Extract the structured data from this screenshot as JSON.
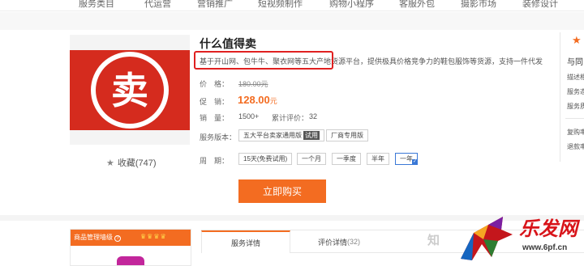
{
  "topnav": {
    "items": [
      "服务类目",
      "代运营",
      "营销推广",
      "短视频制作",
      "购物小程序",
      "客服外包",
      "摄影市场",
      "装修设计"
    ]
  },
  "product": {
    "thumbnail_glyph": "卖",
    "favorites_label": "收藏(747)",
    "title": "什么值得卖",
    "description": "基于开山网、包牛牛、聚衣网等五大产地货源平台，提供极具价格竞争力的鞋包服饰等货源，支持一件代发",
    "price_label": "价　格：",
    "price_value": "180.00元",
    "promo_label": "促　销：",
    "promo_value": "128.00",
    "promo_unit": "元",
    "sales_label": "销　量：",
    "sales_value": "1500+",
    "reviews_label": "累计评价：",
    "reviews_value": "32",
    "version_label": "服务版本：",
    "versions": [
      {
        "label": "五大平台卖家通用版",
        "tag": "试用",
        "selected": false
      },
      {
        "label": "厂商专用版",
        "tag": "",
        "selected": false
      }
    ],
    "period_label": "周　期：",
    "periods": [
      {
        "label": "15天(免费试用)",
        "selected": false
      },
      {
        "label": "一个月",
        "selected": false
      },
      {
        "label": "一季度",
        "selected": false
      },
      {
        "label": "半年",
        "selected": false
      },
      {
        "label": "一年",
        "selected": true
      }
    ],
    "buy_button": "立即购买"
  },
  "sidebar_right": {
    "heading": "与同",
    "rows": [
      "描述相",
      "服务态",
      "服务质"
    ],
    "rows2": [
      "复购率",
      "退款率"
    ]
  },
  "grade_panel": {
    "label": "商品管理墙级",
    "help": "?",
    "crowns": "♛♛♛♛"
  },
  "tabs": [
    {
      "label": "服务详情",
      "count": "",
      "active": true
    },
    {
      "label": "评价详情",
      "count": "(32)",
      "active": false
    }
  ],
  "watermark": {
    "zhihu": "知",
    "brand": "乐发网",
    "url": "www.6pf.cn"
  },
  "colors": {
    "accent": "#f36c21",
    "thumbnail_red": "#d52b1e",
    "highlight_box": "#e02020",
    "selected_border": "#3a78d6"
  }
}
